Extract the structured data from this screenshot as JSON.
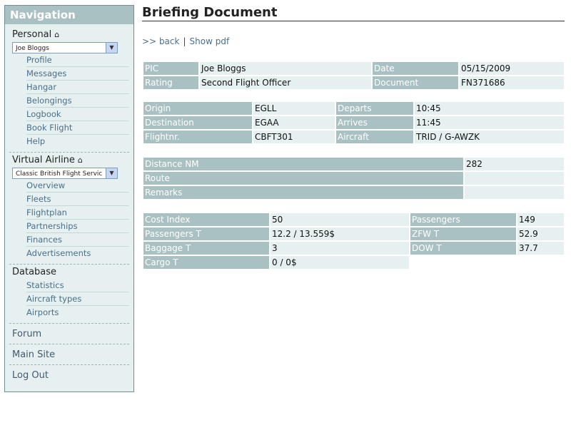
{
  "sidebar": {
    "title": "Navigation",
    "personal": {
      "label": "Personal",
      "home_icon": "home-icon",
      "select_value": "Joe Bloggs",
      "items": [
        "Profile",
        "Messages",
        "Hangar",
        "Belongings",
        "Logbook",
        "Book Flight",
        "Help"
      ]
    },
    "virtual_airline": {
      "label": "Virtual Airline",
      "home_icon": "home-icon",
      "select_value": "Classic British Flight Servic",
      "items": [
        "Overview",
        "Fleets",
        "Flightplan",
        "Partnerships",
        "Finances",
        "Advertisements"
      ]
    },
    "database": {
      "label": "Database",
      "items": [
        "Statistics",
        "Aircraft types",
        "Airports"
      ]
    },
    "forum": "Forum",
    "main_site": "Main Site",
    "log_out": "Log Out"
  },
  "main": {
    "title": "Briefing Document",
    "links": {
      "prefix": ">>",
      "back": "back",
      "separator": "|",
      "show_pdf": "Show pdf"
    },
    "pilot": {
      "pic_label": "PIC",
      "pic": "Joe Bloggs",
      "date_label": "Date",
      "date": "05/15/2009",
      "rating_label": "Rating",
      "rating": "Second Flight Officer",
      "document_label": "Document",
      "document": "FN371686"
    },
    "flight": {
      "origin_label": "Origin",
      "origin": "EGLL",
      "departs_label": "Departs",
      "departs": "10:45",
      "destination_label": "Destination",
      "destination": "EGAA",
      "arrives_label": "Arrives",
      "arrives": "11:45",
      "flightnr_label": "Flightnr.",
      "flightnr": "CBFT301",
      "aircraft_label": "Aircraft",
      "aircraft": "TRID / G-AWZK"
    },
    "route": {
      "distance_label": "Distance NM",
      "distance": "282",
      "route_label": "Route",
      "route": "",
      "remarks_label": "Remarks",
      "remarks": ""
    },
    "load": {
      "cost_index_label": "Cost Index",
      "cost_index": "50",
      "passengers_label": "Passengers",
      "passengers": "149",
      "passengers_t_label": "Passengers T",
      "passengers_t": "12.2 / 13.559$",
      "zfw_t_label": "ZFW T",
      "zfw_t": "52.9",
      "baggage_t_label": "Baggage T",
      "baggage_t": "3",
      "dow_t_label": "DOW T",
      "dow_t": "37.7",
      "cargo_t_label": "Cargo T",
      "cargo_t": "0 / 0$"
    }
  },
  "colors": {
    "label_bg": "#a9c1c2",
    "value_bg": "#e6f0f0",
    "link": "#4a6f88"
  }
}
